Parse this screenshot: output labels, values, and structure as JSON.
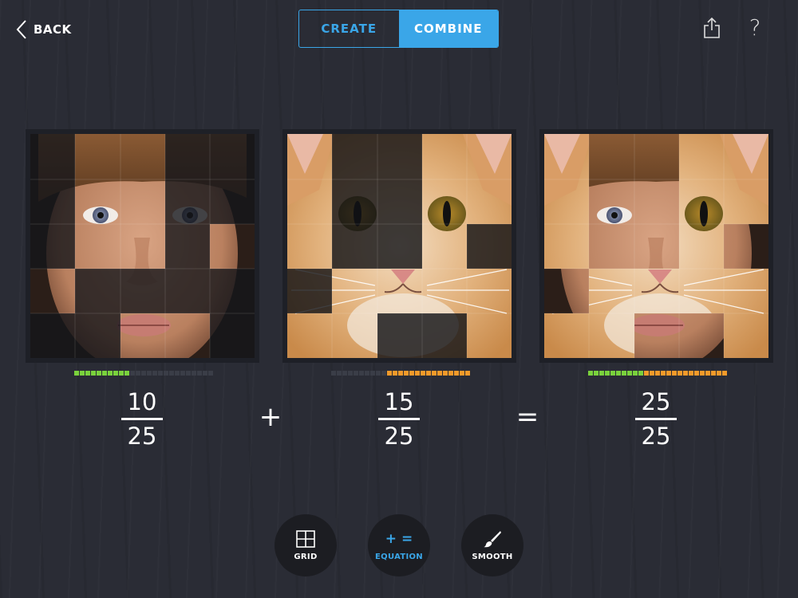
{
  "header": {
    "back_label": "BACK",
    "tabs": [
      {
        "label": "CREATE",
        "active": false
      },
      {
        "label": "COMBINE",
        "active": true
      }
    ],
    "share_icon": "share-icon",
    "help_glyph": "?"
  },
  "equation": {
    "left": {
      "numerator": "10",
      "denominator": "25",
      "image": "boy face"
    },
    "operator": "+",
    "right": {
      "numerator": "15",
      "denominator": "25",
      "image": "cat face"
    },
    "equals": "=",
    "result": {
      "numerator": "25",
      "denominator": "25",
      "image": "combined boy and cat face"
    }
  },
  "meters": {
    "left": {
      "filled": 10,
      "total": 25,
      "color": "#7ad23c"
    },
    "right": {
      "filled": 15,
      "total": 25,
      "color": "#f39a2a"
    },
    "result": {
      "green": 10,
      "orange": 15,
      "total": 25
    }
  },
  "tools": [
    {
      "label": "GRID",
      "icon": "grid-icon",
      "selected": false
    },
    {
      "label": "EQUATION",
      "glyph": "+ =",
      "icon": "equation-icon",
      "selected": true
    },
    {
      "label": "SMOOTH",
      "icon": "brush-icon",
      "selected": false
    }
  ],
  "colors": {
    "accent": "#3aa6e8",
    "background": "#2a2c35",
    "meter_off": "#3a3d47"
  }
}
